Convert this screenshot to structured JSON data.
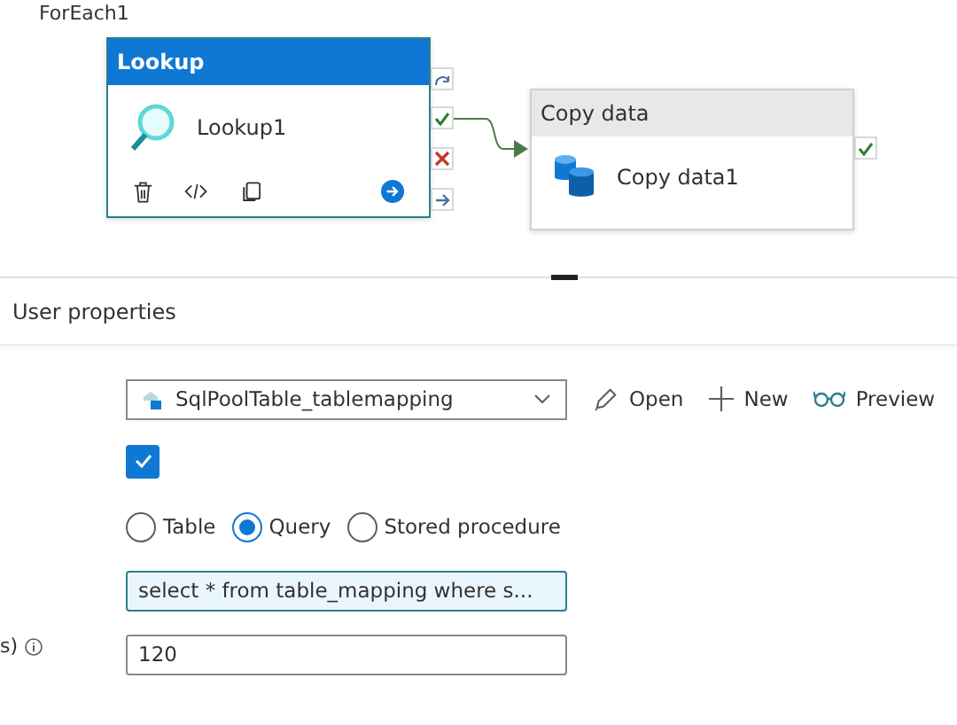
{
  "canvas": {
    "title": "ForEach1",
    "activities": [
      {
        "kind": "lookup",
        "type": "Lookup",
        "name": "Lookup1",
        "selected": true
      },
      {
        "kind": "copy",
        "type": "Copy data",
        "name": "Copy data1",
        "selected": false
      }
    ]
  },
  "tab": {
    "label": "User properties"
  },
  "dataset": {
    "value": "SqlPoolTable_tablemapping"
  },
  "actions": [
    {
      "kind": "edit",
      "label": "Open"
    },
    {
      "kind": "add",
      "label": "New"
    },
    {
      "kind": "preview",
      "label": "Preview"
    }
  ],
  "first_row_only": {
    "checked": true
  },
  "use_query": [
    {
      "label": "Table",
      "selected": false
    },
    {
      "label": "Query",
      "selected": true
    },
    {
      "label": "Stored procedure",
      "selected": false
    }
  ],
  "query": {
    "value": "select * from table_mapping where s..."
  },
  "timeout": {
    "label": "s)",
    "value": "120"
  }
}
